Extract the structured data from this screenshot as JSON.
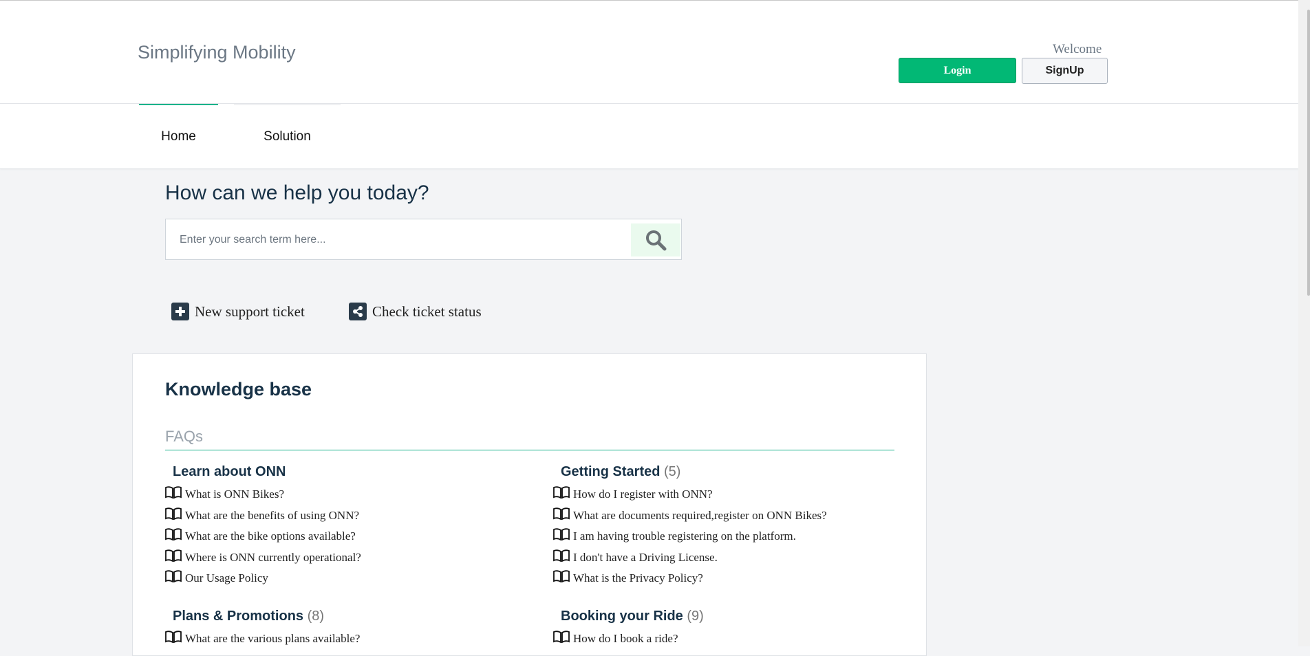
{
  "header": {
    "brand": "Simplifying Mobility",
    "welcome": "Welcome",
    "login_label": "Login",
    "signup_label": "SignUp"
  },
  "nav": {
    "tabs": [
      {
        "label": "Home",
        "active": true
      },
      {
        "label": "Solution",
        "active": false
      }
    ]
  },
  "help": {
    "title": "How can we help you today?",
    "search_placeholder": "Enter your search term here...",
    "search_icon": "search-icon"
  },
  "actions": [
    {
      "label": "New support ticket",
      "icon": "plus-square-icon"
    },
    {
      "label": "Check ticket status",
      "icon": "share-square-icon"
    }
  ],
  "knowledge_base": {
    "title": "Knowledge base",
    "section": "FAQs",
    "categories": [
      {
        "title": "Learn about ONN",
        "count": "",
        "articles": [
          "What is ONN Bikes?",
          "What are the benefits of using ONN?",
          "What are the bike options available?",
          "Where is ONN currently operational?",
          "Our Usage Policy"
        ]
      },
      {
        "title": "Getting Started",
        "count": "(5)",
        "articles": [
          "How do I register with ONN?",
          "What are documents required,register on ONN Bikes?",
          "I am having trouble registering on the platform.",
          "I don't have a Driving License.",
          "What is the Privacy Policy?"
        ]
      },
      {
        "title": "Plans & Promotions",
        "count": "(8)",
        "articles": [
          "What are the various plans available?"
        ]
      },
      {
        "title": "Booking your Ride",
        "count": "(9)",
        "articles": [
          "How do I book a ride?"
        ]
      }
    ]
  },
  "colors": {
    "accent": "#02b875",
    "tab_underline": "#0fb38a",
    "heading": "#183247"
  }
}
